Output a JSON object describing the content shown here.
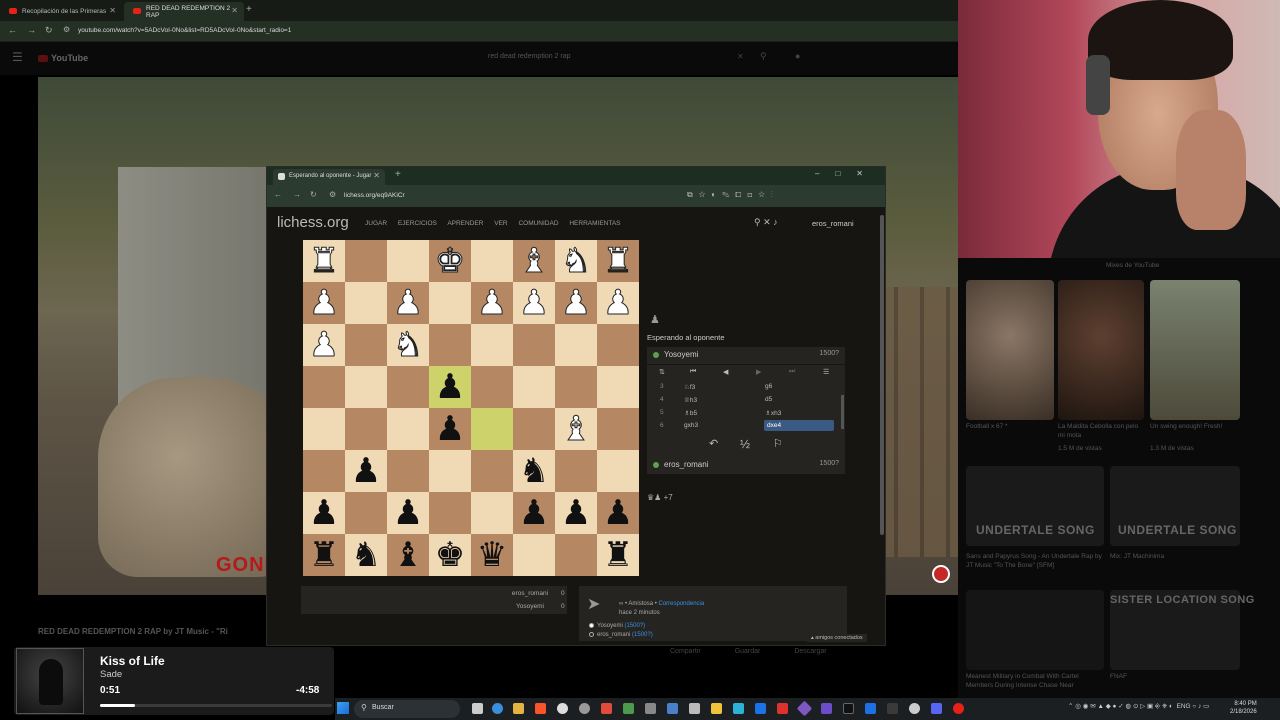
{
  "outer_browser": {
    "tabs": [
      {
        "title": "Recopilación de las Primeras"
      },
      {
        "title": "RED DEAD REDEMPTION 2 RAP"
      }
    ],
    "url": "youtube.com/watch?v=5ADcVoI-0No&list=RD5ADcVoI-0No&start_radio=1"
  },
  "youtube": {
    "logo": "YouTube",
    "search_value": "red dead redemption 2 rap",
    "video_overlay_text": "GONN",
    "video_title": "RED DEAD REDEMPTION 2 RAP by JT Music - \"Ri",
    "actions": [
      "Compartir",
      "Guardar",
      "Descargar"
    ],
    "sidebar": {
      "filter_label": "Mixes de YouTube",
      "items": [
        {
          "title": "Football x 67 *",
          "meta": ""
        },
        {
          "title": "La Maldita Cebolla con pelo mi mota",
          "meta": "1.5 M de vistas"
        },
        {
          "title": "Un swing enough! Fresh!",
          "meta": "1.3 M de vistas"
        },
        {
          "title": "Sans and Papyrus Song - An Undertale Rap by JT Music \"To The Bone\" [SFM]",
          "meta": ""
        },
        {
          "title": "Mix: JT Machinima",
          "meta": ""
        },
        {
          "title": "Meanest Military in Combat With Cartel Members During Intense Chase Near",
          "meta": ""
        },
        {
          "title": "FNAF",
          "meta": ""
        }
      ],
      "banners": [
        "UNDERTALE SONG",
        "UNDERTALE SONG",
        "SISTER LOCATION SONG"
      ]
    }
  },
  "music": {
    "title": "Kiss of Life",
    "artist": "Sade",
    "elapsed": "0:51",
    "remaining": "-4:58",
    "progress_fraction": 0.15
  },
  "taskbar": {
    "search": "Buscar",
    "lang": "ENG",
    "time": "8:40 PM",
    "date": "2/18/2026"
  },
  "inner_browser": {
    "tab_title": "Esperando al oponente - Jugar",
    "url": "lichess.org/eq9AKiCr"
  },
  "lichess": {
    "logo": "lichess.org",
    "nav": [
      "JUGAR",
      "EJERCICIOS",
      "APRENDER",
      "VER",
      "COMUNIDAD",
      "HERRAMIENTAS"
    ],
    "username": "eros_romani",
    "waiting_label": "Esperando al oponente",
    "top_player": {
      "name": "Yosoyemi",
      "rating": "1500?"
    },
    "bottom_player": {
      "name": "eros_romani",
      "rating": "1500?"
    },
    "moves": [
      {
        "n": "3",
        "w": "♘f3",
        "b": "g6"
      },
      {
        "n": "4",
        "w": "♕h3",
        "b": "d5"
      },
      {
        "n": "5",
        "w": "♗b5",
        "b": "♗xh3"
      },
      {
        "n": "6",
        "w": "gxh3",
        "b": "dxe4"
      }
    ],
    "material": "♛♟ +7",
    "crosstable": [
      {
        "name": "eros_romani",
        "score": "0"
      },
      {
        "name": "Yosoyemi",
        "score": "0"
      }
    ],
    "game_info": {
      "type_prefix": "∞ • Amistosa • ",
      "type_link": "Correspondencia",
      "time_ago": "hace 2 minutos",
      "player1_name": "Yosoyemi",
      "player1_rating": "(1500?)",
      "player2_name": "eros_romani",
      "player2_rating": "(1500?)"
    },
    "friends_label": "▴ amigos conectados",
    "board": [
      [
        "wR",
        "",
        "",
        "wK",
        "",
        "wB",
        "wN",
        "wR"
      ],
      [
        "wP",
        "",
        "wP",
        "",
        "wP",
        "wP",
        "wP",
        "wP"
      ],
      [
        "wP",
        "",
        "wN",
        "",
        "",
        "",
        "",
        ""
      ],
      [
        "",
        "",
        "",
        "bP",
        "",
        "",
        "",
        ""
      ],
      [
        "",
        "",
        "",
        "bP",
        "",
        "",
        "wB",
        ""
      ],
      [
        "",
        "bP",
        "",
        "",
        "",
        "bN",
        "",
        ""
      ],
      [
        "bP",
        "",
        "bP",
        "",
        "",
        "bP",
        "bP",
        "bP"
      ],
      [
        "bR",
        "bN",
        "bB",
        "bK",
        "bQ",
        "",
        "",
        "bR"
      ]
    ]
  }
}
